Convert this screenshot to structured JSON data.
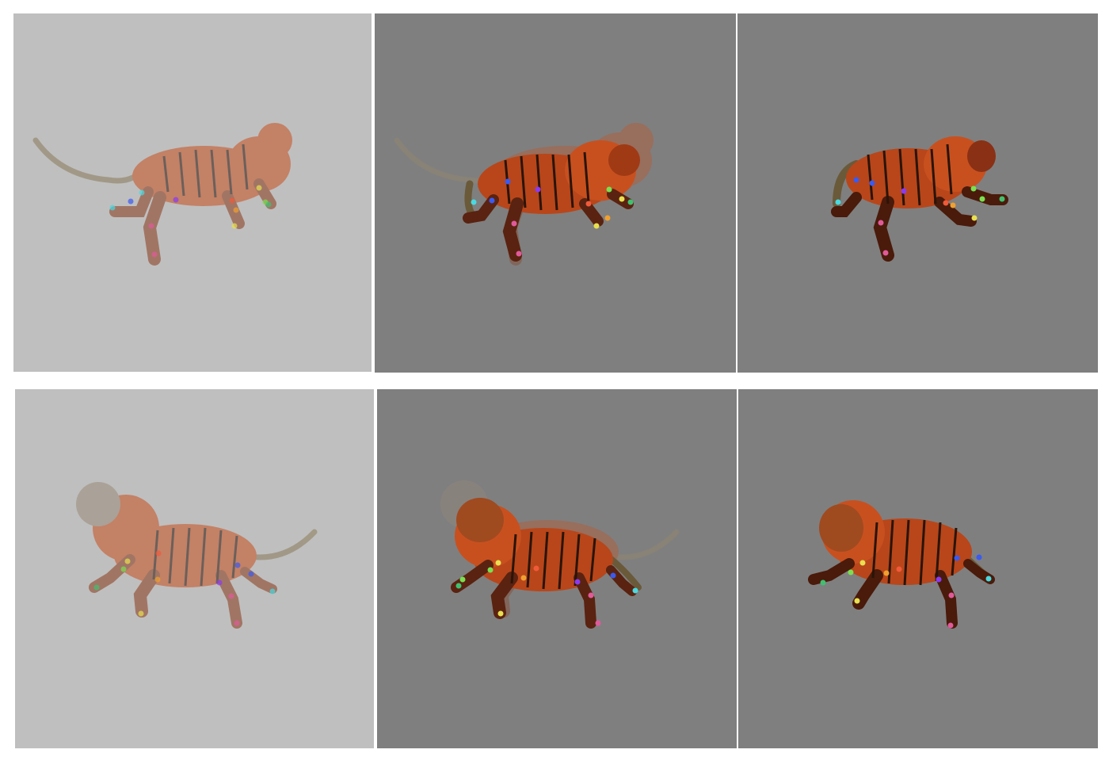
{
  "grid": {
    "rows": 2,
    "columns": 3,
    "row_1_facing": "right",
    "row_2_facing": "left"
  },
  "panels": [
    {
      "id": "p1",
      "background": "#bfbfbf",
      "render": "faded-single"
    },
    {
      "id": "p2",
      "background": "#7f7f7f",
      "render": "overlay-ghost"
    },
    {
      "id": "p3",
      "background": "#7f7f7f",
      "render": "solid-single"
    },
    {
      "id": "p4",
      "background": "#bfbfbf",
      "render": "faded-single"
    },
    {
      "id": "p5",
      "background": "#7f7f7f",
      "render": "overlay-ghost"
    },
    {
      "id": "p6",
      "background": "#7f7f7f",
      "render": "solid-single"
    }
  ],
  "subject": "tiger-3d-render",
  "colors": {
    "fur": "#c8501f",
    "fur_dark": "#6a2410",
    "belly": "#8a8a9a",
    "stripe": "#2a1408",
    "keypoints": [
      "#4ad9e0",
      "#3a5af0",
      "#8a3af0",
      "#e05a9a",
      "#f05a3a",
      "#f0a030",
      "#e8e050",
      "#7ae050",
      "#40c070"
    ]
  }
}
